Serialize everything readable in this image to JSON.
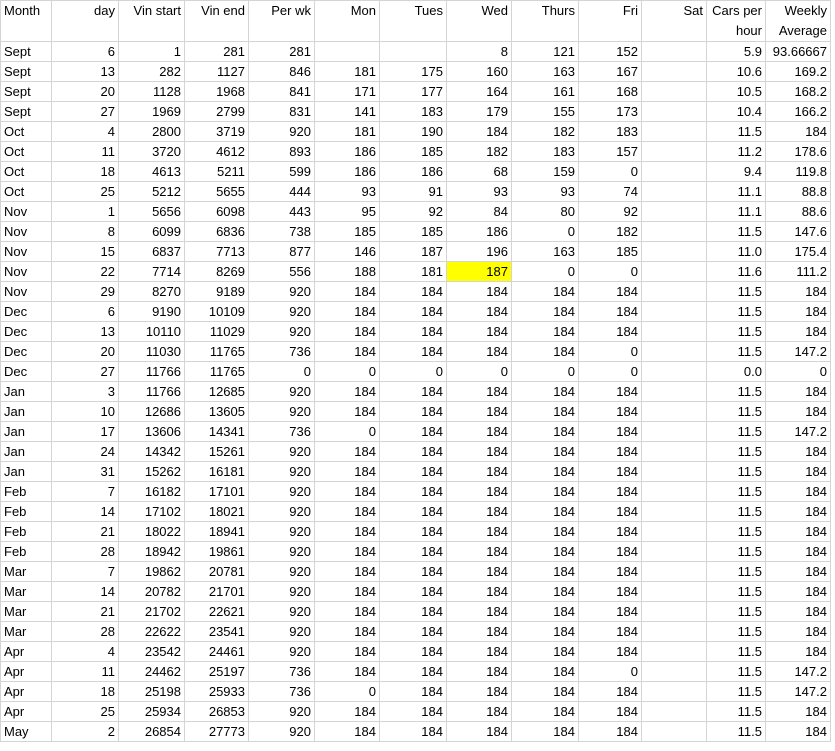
{
  "sheet": {
    "headers": [
      "Month",
      "day",
      "Vin start",
      "Vin end",
      "Per wk",
      "Mon",
      "Tues",
      "Wed",
      "Thurs",
      "Fri",
      "Sat",
      "Cars per hour",
      "Weekly Average"
    ],
    "highlight": {
      "row": 11,
      "col": 7,
      "color": "#ffff00"
    },
    "rows": [
      [
        "Sept",
        "6",
        "1",
        "281",
        "281",
        "",
        "",
        "8",
        "121",
        "152",
        "",
        "5.9",
        "93.66667"
      ],
      [
        "Sept",
        "13",
        "282",
        "1127",
        "846",
        "181",
        "175",
        "160",
        "163",
        "167",
        "",
        "10.6",
        "169.2"
      ],
      [
        "Sept",
        "20",
        "1128",
        "1968",
        "841",
        "171",
        "177",
        "164",
        "161",
        "168",
        "",
        "10.5",
        "168.2"
      ],
      [
        "Sept",
        "27",
        "1969",
        "2799",
        "831",
        "141",
        "183",
        "179",
        "155",
        "173",
        "",
        "10.4",
        "166.2"
      ],
      [
        "Oct",
        "4",
        "2800",
        "3719",
        "920",
        "181",
        "190",
        "184",
        "182",
        "183",
        "",
        "11.5",
        "184"
      ],
      [
        "Oct",
        "11",
        "3720",
        "4612",
        "893",
        "186",
        "185",
        "182",
        "183",
        "157",
        "",
        "11.2",
        "178.6"
      ],
      [
        "Oct",
        "18",
        "4613",
        "5211",
        "599",
        "186",
        "186",
        "68",
        "159",
        "0",
        "",
        "9.4",
        "119.8"
      ],
      [
        "Oct",
        "25",
        "5212",
        "5655",
        "444",
        "93",
        "91",
        "93",
        "93",
        "74",
        "",
        "11.1",
        "88.8"
      ],
      [
        "Nov",
        "1",
        "5656",
        "6098",
        "443",
        "95",
        "92",
        "84",
        "80",
        "92",
        "",
        "11.1",
        "88.6"
      ],
      [
        "Nov",
        "8",
        "6099",
        "6836",
        "738",
        "185",
        "185",
        "186",
        "0",
        "182",
        "",
        "11.5",
        "147.6"
      ],
      [
        "Nov",
        "15",
        "6837",
        "7713",
        "877",
        "146",
        "187",
        "196",
        "163",
        "185",
        "",
        "11.0",
        "175.4"
      ],
      [
        "Nov",
        "22",
        "7714",
        "8269",
        "556",
        "188",
        "181",
        "187",
        "0",
        "0",
        "",
        "11.6",
        "111.2"
      ],
      [
        "Nov",
        "29",
        "8270",
        "9189",
        "920",
        "184",
        "184",
        "184",
        "184",
        "184",
        "",
        "11.5",
        "184"
      ],
      [
        "Dec",
        "6",
        "9190",
        "10109",
        "920",
        "184",
        "184",
        "184",
        "184",
        "184",
        "",
        "11.5",
        "184"
      ],
      [
        "Dec",
        "13",
        "10110",
        "11029",
        "920",
        "184",
        "184",
        "184",
        "184",
        "184",
        "",
        "11.5",
        "184"
      ],
      [
        "Dec",
        "20",
        "11030",
        "11765",
        "736",
        "184",
        "184",
        "184",
        "184",
        "0",
        "",
        "11.5",
        "147.2"
      ],
      [
        "Dec",
        "27",
        "11766",
        "11765",
        "0",
        "0",
        "0",
        "0",
        "0",
        "0",
        "",
        "0.0",
        "0"
      ],
      [
        "Jan",
        "3",
        "11766",
        "12685",
        "920",
        "184",
        "184",
        "184",
        "184",
        "184",
        "",
        "11.5",
        "184"
      ],
      [
        "Jan",
        "10",
        "12686",
        "13605",
        "920",
        "184",
        "184",
        "184",
        "184",
        "184",
        "",
        "11.5",
        "184"
      ],
      [
        "Jan",
        "17",
        "13606",
        "14341",
        "736",
        "0",
        "184",
        "184",
        "184",
        "184",
        "",
        "11.5",
        "147.2"
      ],
      [
        "Jan",
        "24",
        "14342",
        "15261",
        "920",
        "184",
        "184",
        "184",
        "184",
        "184",
        "",
        "11.5",
        "184"
      ],
      [
        "Jan",
        "31",
        "15262",
        "16181",
        "920",
        "184",
        "184",
        "184",
        "184",
        "184",
        "",
        "11.5",
        "184"
      ],
      [
        "Feb",
        "7",
        "16182",
        "17101",
        "920",
        "184",
        "184",
        "184",
        "184",
        "184",
        "",
        "11.5",
        "184"
      ],
      [
        "Feb",
        "14",
        "17102",
        "18021",
        "920",
        "184",
        "184",
        "184",
        "184",
        "184",
        "",
        "11.5",
        "184"
      ],
      [
        "Feb",
        "21",
        "18022",
        "18941",
        "920",
        "184",
        "184",
        "184",
        "184",
        "184",
        "",
        "11.5",
        "184"
      ],
      [
        "Feb",
        "28",
        "18942",
        "19861",
        "920",
        "184",
        "184",
        "184",
        "184",
        "184",
        "",
        "11.5",
        "184"
      ],
      [
        "Mar",
        "7",
        "19862",
        "20781",
        "920",
        "184",
        "184",
        "184",
        "184",
        "184",
        "",
        "11.5",
        "184"
      ],
      [
        "Mar",
        "14",
        "20782",
        "21701",
        "920",
        "184",
        "184",
        "184",
        "184",
        "184",
        "",
        "11.5",
        "184"
      ],
      [
        "Mar",
        "21",
        "21702",
        "22621",
        "920",
        "184",
        "184",
        "184",
        "184",
        "184",
        "",
        "11.5",
        "184"
      ],
      [
        "Mar",
        "28",
        "22622",
        "23541",
        "920",
        "184",
        "184",
        "184",
        "184",
        "184",
        "",
        "11.5",
        "184"
      ],
      [
        "Apr",
        "4",
        "23542",
        "24461",
        "920",
        "184",
        "184",
        "184",
        "184",
        "184",
        "",
        "11.5",
        "184"
      ],
      [
        "Apr",
        "11",
        "24462",
        "25197",
        "736",
        "184",
        "184",
        "184",
        "184",
        "0",
        "",
        "11.5",
        "147.2"
      ],
      [
        "Apr",
        "18",
        "25198",
        "25933",
        "736",
        "0",
        "184",
        "184",
        "184",
        "184",
        "",
        "11.5",
        "147.2"
      ],
      [
        "Apr",
        "25",
        "25934",
        "26853",
        "920",
        "184",
        "184",
        "184",
        "184",
        "184",
        "",
        "11.5",
        "184"
      ],
      [
        "May",
        "2",
        "26854",
        "27773",
        "920",
        "184",
        "184",
        "184",
        "184",
        "184",
        "",
        "11.5",
        "184"
      ]
    ]
  }
}
